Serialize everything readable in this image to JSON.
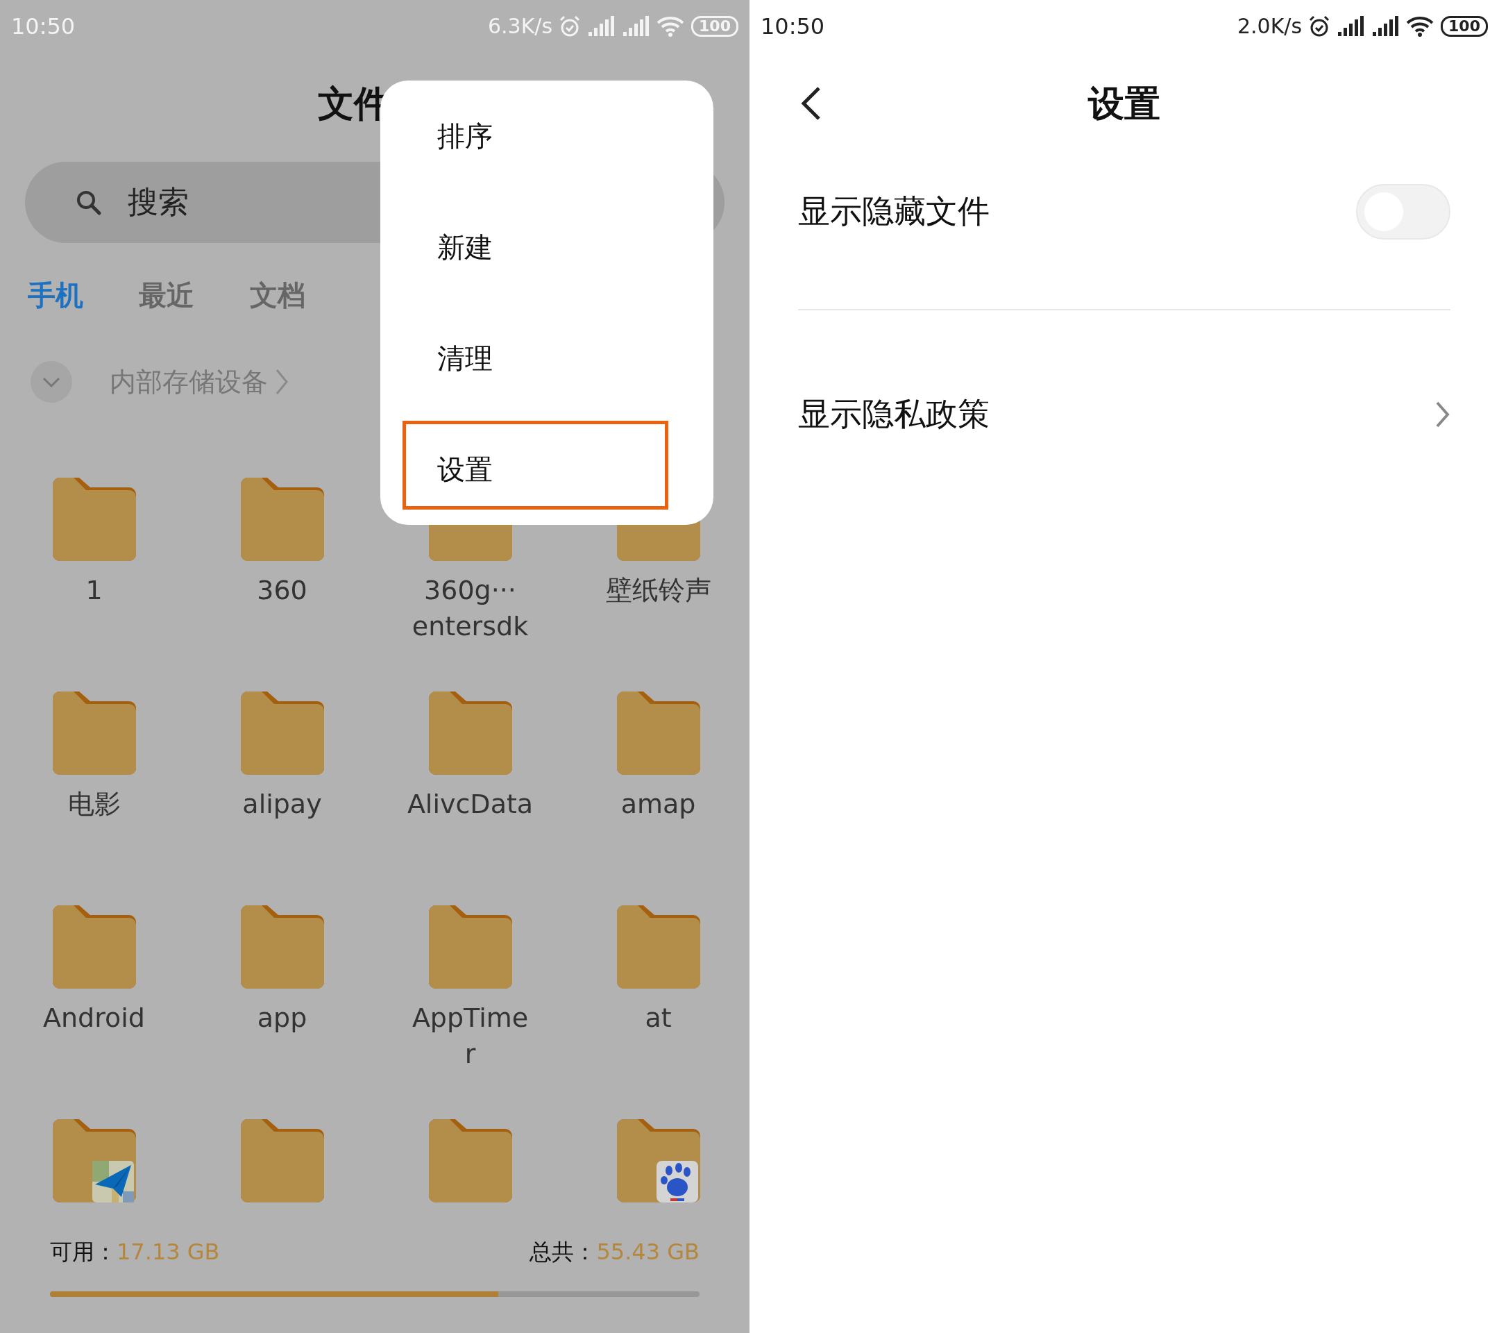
{
  "file_screen": {
    "status_bar": {
      "time": "10:50",
      "speed": "6.3K/s",
      "battery": "100"
    },
    "title": "文件",
    "search": {
      "placeholder": "搜索"
    },
    "tabs": [
      {
        "label": "手机",
        "selected": true
      },
      {
        "label": "最近",
        "selected": false
      },
      {
        "label": "文档",
        "selected": false
      }
    ],
    "breadcrumb": {
      "label": "内部存储设备",
      "expanded": false
    },
    "folders": [
      {
        "lines": [
          "1"
        ]
      },
      {
        "lines": [
          "360"
        ]
      },
      {
        "lines": [
          "360g···",
          "entersdk"
        ]
      },
      {
        "lines": [
          "壁纸铃声"
        ]
      },
      {
        "lines": [
          "电影"
        ]
      },
      {
        "lines": [
          "alipay"
        ]
      },
      {
        "lines": [
          "AlivcData"
        ]
      },
      {
        "lines": [
          "amap"
        ]
      },
      {
        "lines": [
          "Android"
        ]
      },
      {
        "lines": [
          "app"
        ]
      },
      {
        "lines": [
          "AppTime",
          "r"
        ]
      },
      {
        "lines": [
          "at"
        ]
      },
      {
        "kind": "plane"
      },
      {
        "kind": "plain"
      },
      {
        "kind": "plain"
      },
      {
        "kind": "paw"
      }
    ],
    "storage": {
      "free_label": "可用：",
      "free": "17.13 GB",
      "total_label": "总共：",
      "total": "55.43 GB",
      "level": 0.69
    },
    "menu": [
      {
        "label": "排序",
        "highlighted": false
      },
      {
        "label": "新建",
        "highlighted": false
      },
      {
        "label": "清理",
        "highlighted": false
      },
      {
        "label": "设置",
        "highlighted": true
      }
    ]
  },
  "settings_screen": {
    "status_bar": {
      "time": "10:50",
      "speed": "2.0K/s",
      "battery": "100"
    },
    "title": "设置",
    "items": [
      {
        "kind": "toggle",
        "label": "显示隐藏文件",
        "on": false
      },
      {
        "kind": "link",
        "label": "显示隐私政策"
      }
    ]
  }
}
